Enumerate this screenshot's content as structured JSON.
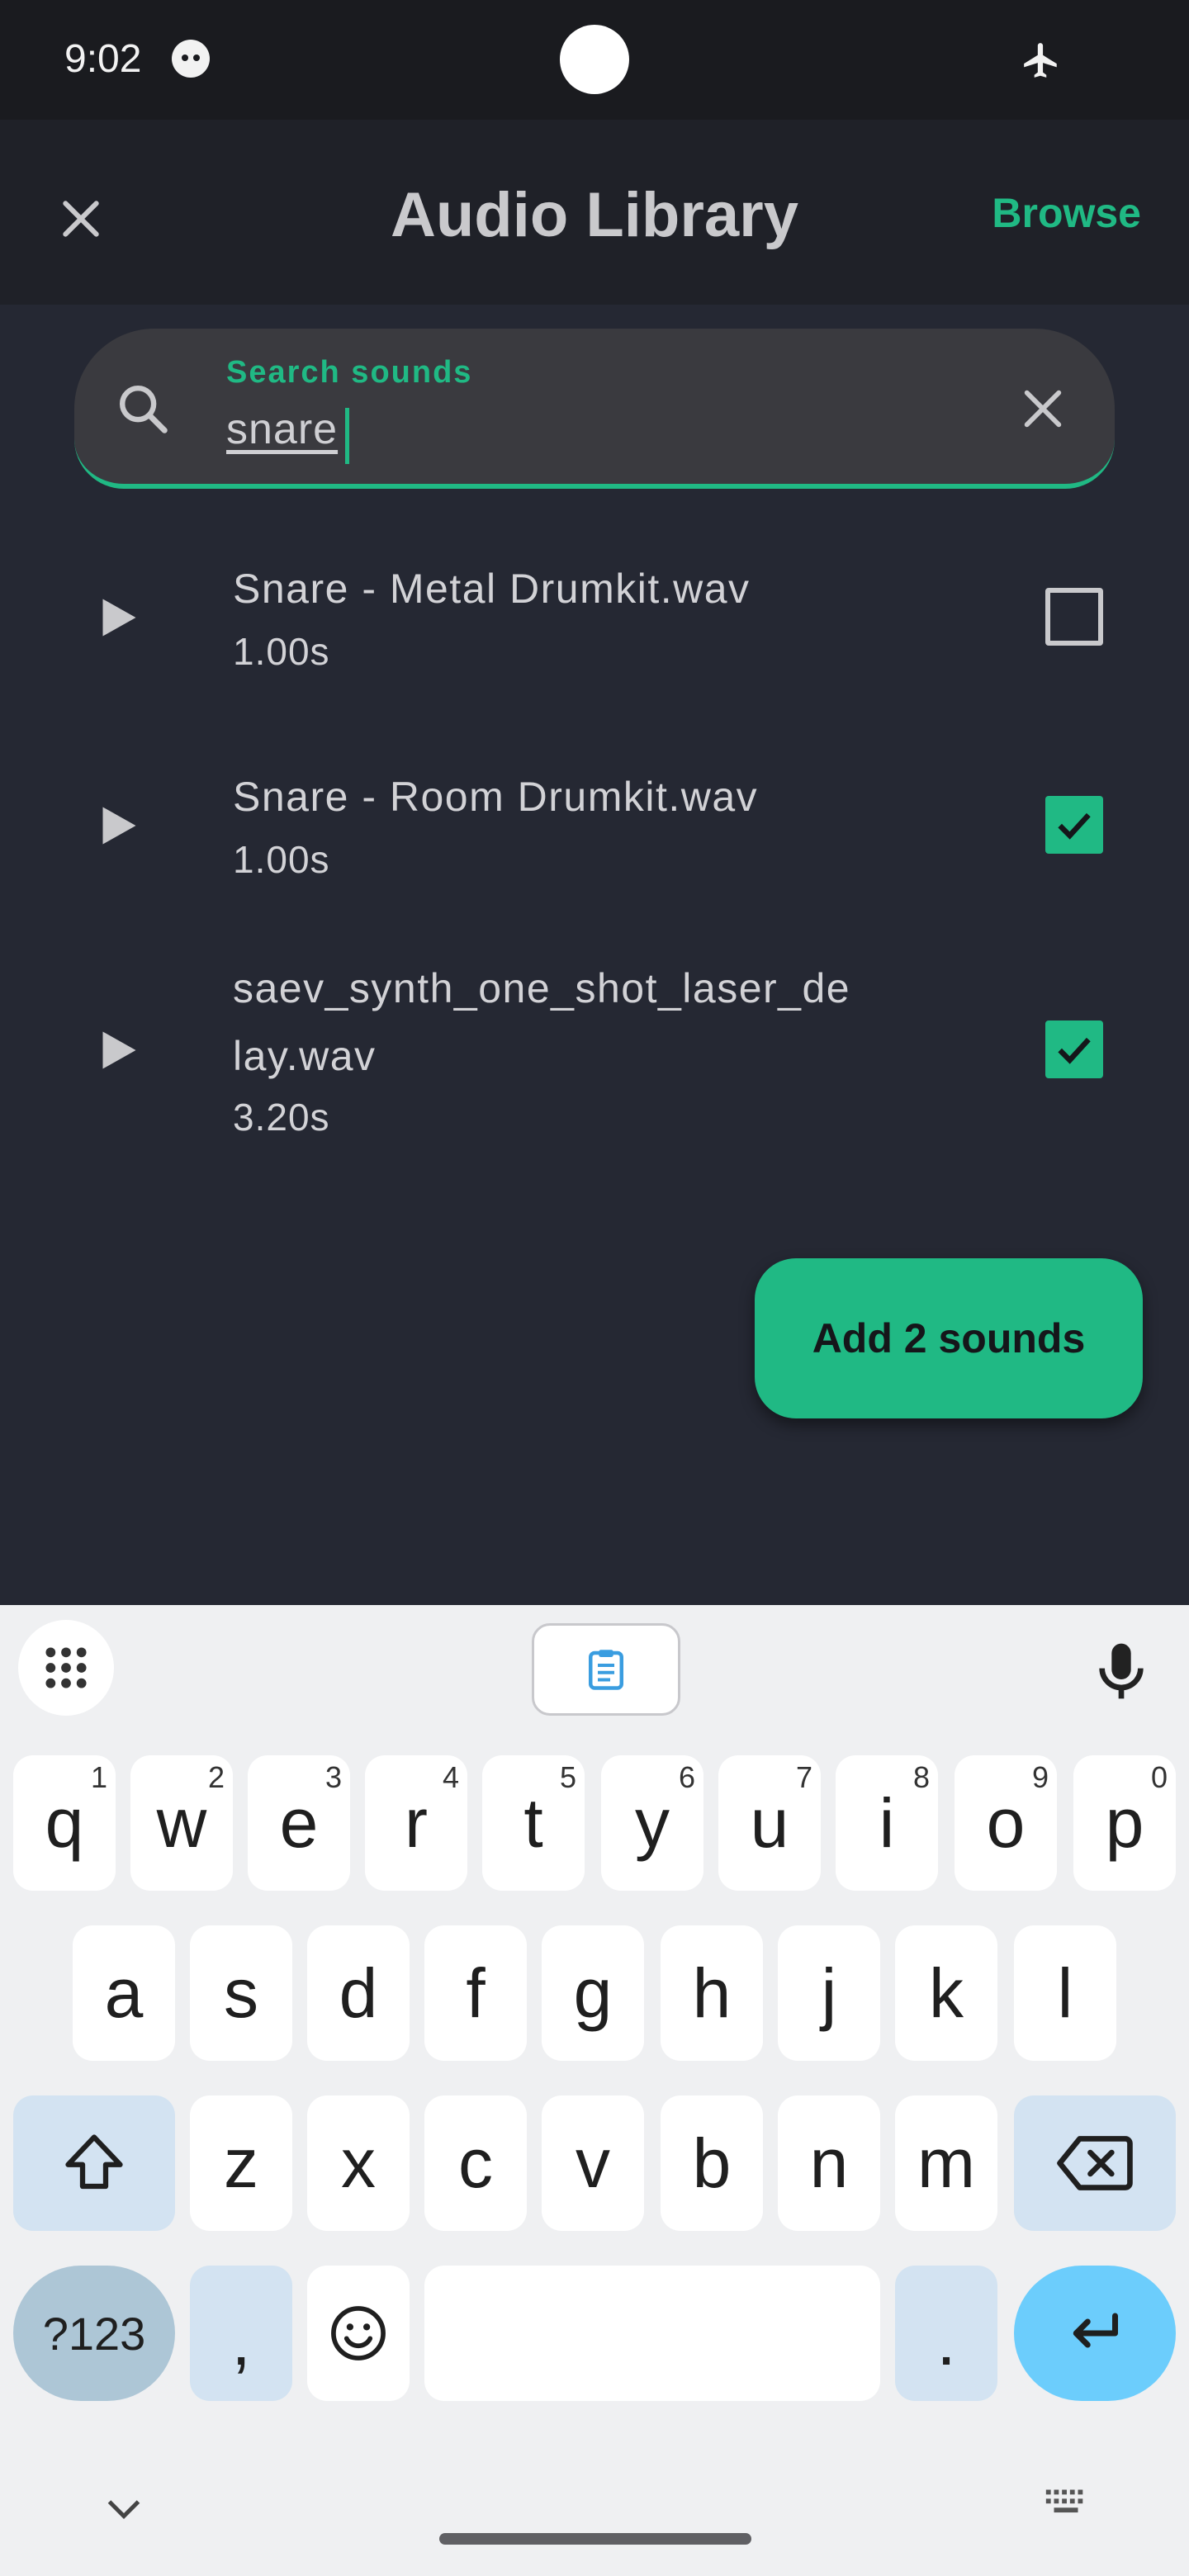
{
  "status_bar": {
    "time": "9:02"
  },
  "app_bar": {
    "title": "Audio Library",
    "browse_label": "Browse"
  },
  "search": {
    "label": "Search sounds",
    "value": "snare"
  },
  "items": [
    {
      "name": "Snare - Metal Drumkit.wav",
      "duration": "1.00s",
      "checked": false
    },
    {
      "name": "Snare - Room Drumkit.wav",
      "duration": "1.00s",
      "checked": true
    },
    {
      "name": "saev_synth_one_shot_laser_de lay.wav",
      "duration": "3.20s",
      "checked": true
    }
  ],
  "add_button": {
    "label": "Add 2 sounds"
  },
  "keyboard": {
    "row1": [
      {
        "key": "q",
        "hint": "1"
      },
      {
        "key": "w",
        "hint": "2"
      },
      {
        "key": "e",
        "hint": "3"
      },
      {
        "key": "r",
        "hint": "4"
      },
      {
        "key": "t",
        "hint": "5"
      },
      {
        "key": "y",
        "hint": "6"
      },
      {
        "key": "u",
        "hint": "7"
      },
      {
        "key": "i",
        "hint": "8"
      },
      {
        "key": "o",
        "hint": "9"
      },
      {
        "key": "p",
        "hint": "0"
      }
    ],
    "row2": [
      "a",
      "s",
      "d",
      "f",
      "g",
      "h",
      "j",
      "k",
      "l"
    ],
    "row3": [
      "z",
      "x",
      "c",
      "v",
      "b",
      "n",
      "m"
    ],
    "symbols_label": "?123",
    "comma": ",",
    "period": "."
  },
  "colors": {
    "accent": "#20b984",
    "background": "#252833",
    "app_bar": "#1f2128"
  }
}
